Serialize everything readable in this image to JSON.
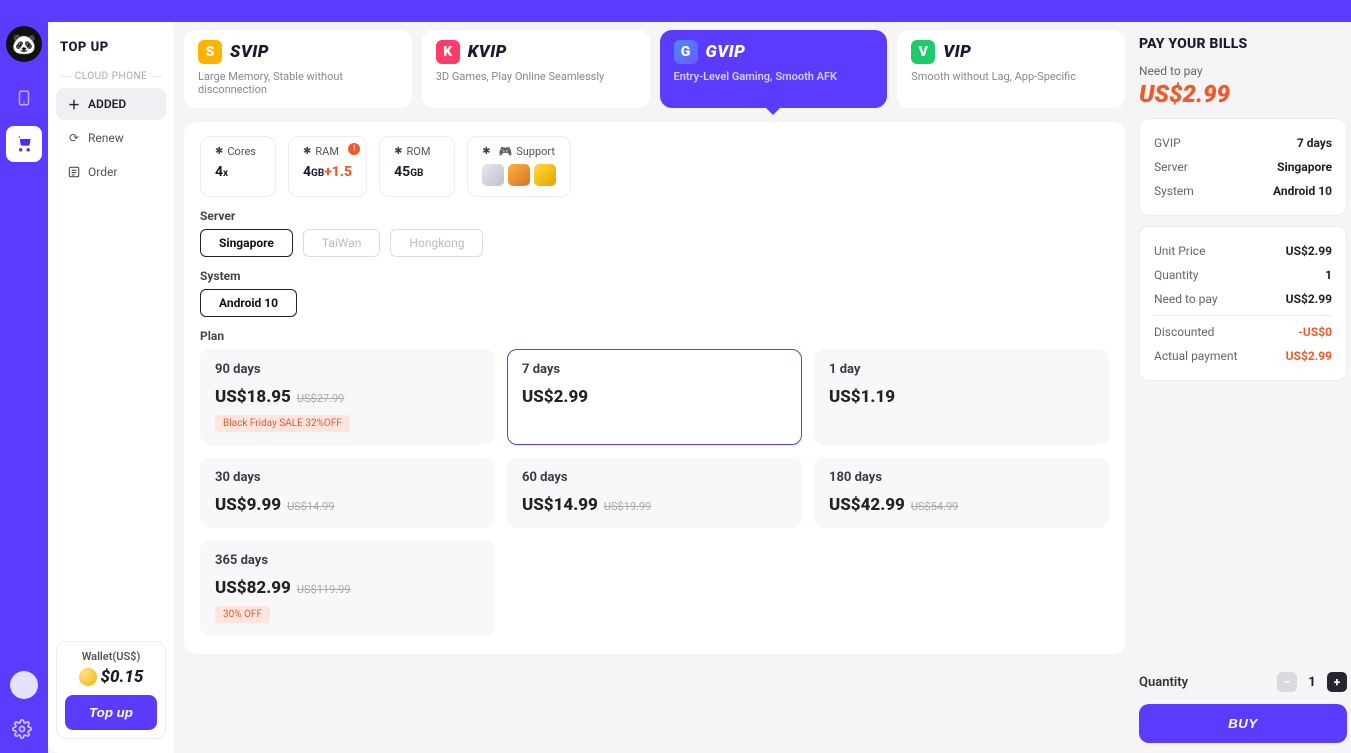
{
  "sidebar": {
    "title": "TOP UP",
    "category": "CLOUD PHONE",
    "nav": [
      "ADDED",
      "Renew",
      "Order"
    ],
    "wallet": {
      "label": "Wallet(US$)",
      "amount": "$0.15",
      "button": "Top up"
    }
  },
  "tiers": [
    {
      "name": "SVIP",
      "desc": "Large Memory, Stable without disconnection"
    },
    {
      "name": "KVIP",
      "desc": "3D Games, Play Online Seamlessly"
    },
    {
      "name": "GVIP",
      "desc": "Entry-Level Gaming, Smooth AFK"
    },
    {
      "name": "VIP",
      "desc": "Smooth without Lag, App-Specific"
    }
  ],
  "specs": {
    "cores": {
      "label": "Cores",
      "value": "4",
      "unit": "x"
    },
    "ram": {
      "label": "RAM",
      "value": "4",
      "unit": "GB",
      "bonus": "+1.5"
    },
    "rom": {
      "label": "ROM",
      "value": "45",
      "unit": "GB"
    },
    "support": {
      "label": "Support"
    }
  },
  "server": {
    "label": "Server",
    "options": [
      "Singapore",
      "TaiWan",
      "Hongkong"
    ]
  },
  "system": {
    "label": "System",
    "options": [
      "Android 10"
    ]
  },
  "plan": {
    "label": "Plan",
    "options": [
      {
        "duration": "90 days",
        "price": "US$18.95",
        "old": "US$27.99",
        "tag": "Black Friday SALE 32%OFF"
      },
      {
        "duration": "7 days",
        "price": "US$2.99"
      },
      {
        "duration": "1 day",
        "price": "US$1.19"
      },
      {
        "duration": "30 days",
        "price": "US$9.99",
        "old": "US$14.99"
      },
      {
        "duration": "60 days",
        "price": "US$14.99",
        "old": "US$19.99"
      },
      {
        "duration": "180 days",
        "price": "US$42.99",
        "old": "US$54.99"
      },
      {
        "duration": "365 days",
        "price": "US$82.99",
        "old": "US$119.99",
        "tag": "30% OFF"
      }
    ]
  },
  "pay": {
    "title": "PAY YOUR BILLS",
    "need_label": "Need to pay",
    "amount": "US$2.99",
    "summary": [
      {
        "k": "GVIP",
        "v": "7 days"
      },
      {
        "k": "Server",
        "v": "Singapore"
      },
      {
        "k": "System",
        "v": "Android 10"
      }
    ],
    "price": [
      {
        "k": "Unit Price",
        "v": "US$2.99"
      },
      {
        "k": "Quantity",
        "v": "1"
      },
      {
        "k": "Need to pay",
        "v": "US$2.99"
      },
      {
        "k": "Discounted",
        "v": "-US$0"
      },
      {
        "k": "Actual payment",
        "v": "US$2.99"
      }
    ],
    "qty": {
      "label": "Quantity",
      "value": "1"
    },
    "buy_label": "BUY"
  }
}
